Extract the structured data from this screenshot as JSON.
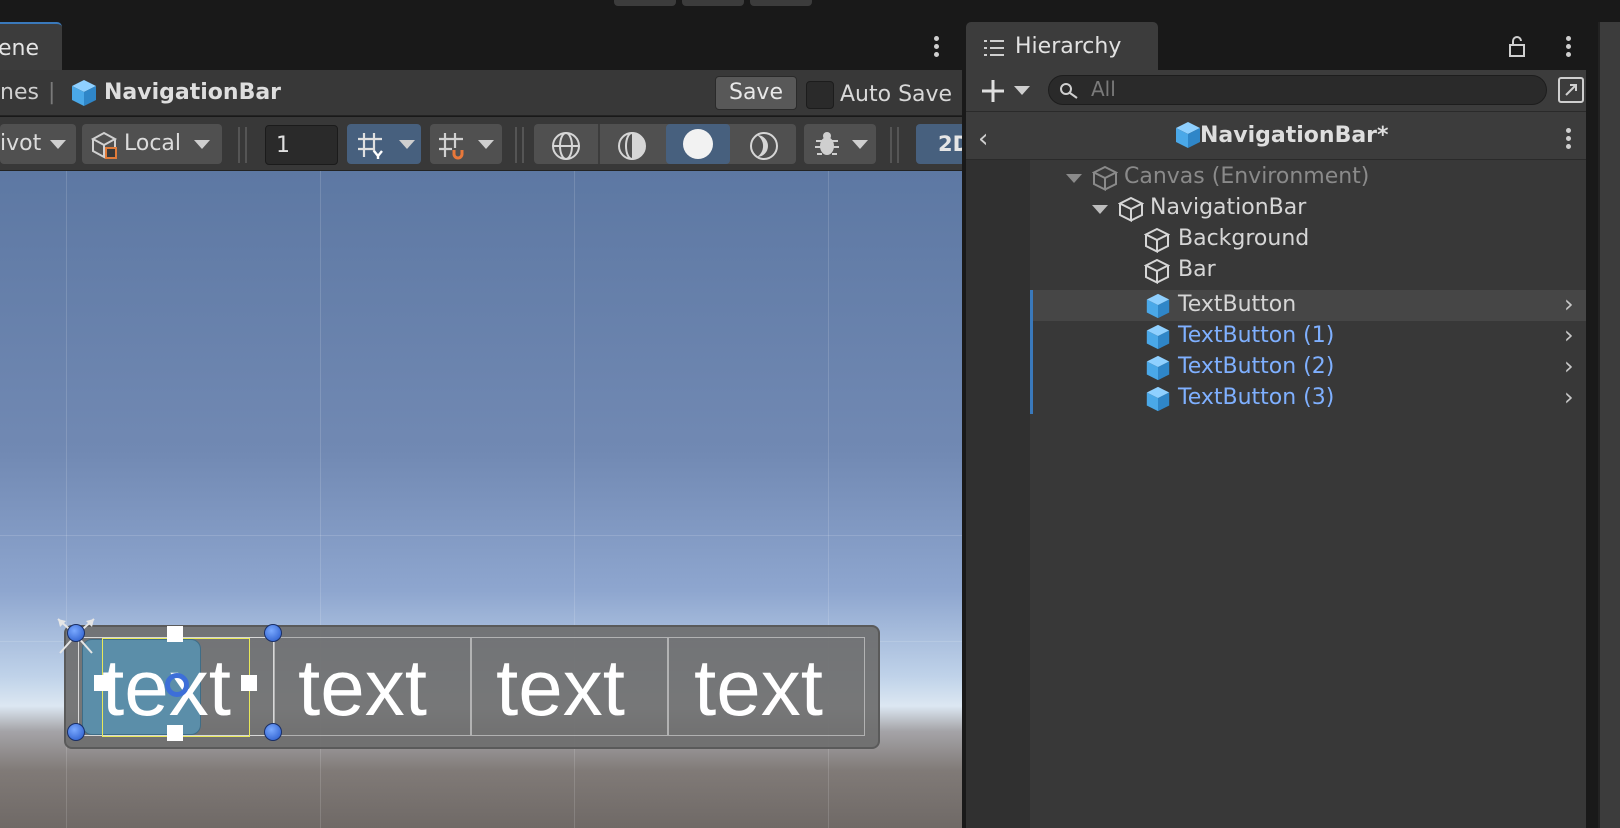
{
  "scene": {
    "tab_label": "ene",
    "breadcrumb_prev": "nes",
    "breadcrumb_sep": "|",
    "breadcrumb_title": "NavigationBar",
    "save_label": "Save",
    "auto_save_label": "Auto Save",
    "auto_save_checked": false,
    "toolbar": {
      "pivot_label": "ivot",
      "space_label": "Local",
      "snap_value": "1",
      "mode_2d": "2D"
    },
    "nav_buttons": [
      "text",
      "text",
      "text",
      "text"
    ]
  },
  "hierarchy": {
    "tab_label": "Hierarchy",
    "search_placeholder": "All",
    "header_title": "NavigationBar*",
    "items": [
      {
        "label": "Canvas (Environment)",
        "color": "#8a8a8a"
      },
      {
        "label": "NavigationBar",
        "color": "#d6d6d6"
      },
      {
        "label": "Background",
        "color": "#d6d6d6"
      },
      {
        "label": "Bar",
        "color": "#d6d6d6"
      },
      {
        "label": "TextButton",
        "color": "#d6d6d6"
      },
      {
        "label": "TextButton (1)",
        "color": "#7fb0ff"
      },
      {
        "label": "TextButton (2)",
        "color": "#7fb0ff"
      },
      {
        "label": "TextButton (3)",
        "color": "#7fb0ff"
      }
    ]
  },
  "colors": {
    "accent": "#3a79bb",
    "selection_active": "#47607e",
    "prefab_icon": "#5fb4f0"
  }
}
